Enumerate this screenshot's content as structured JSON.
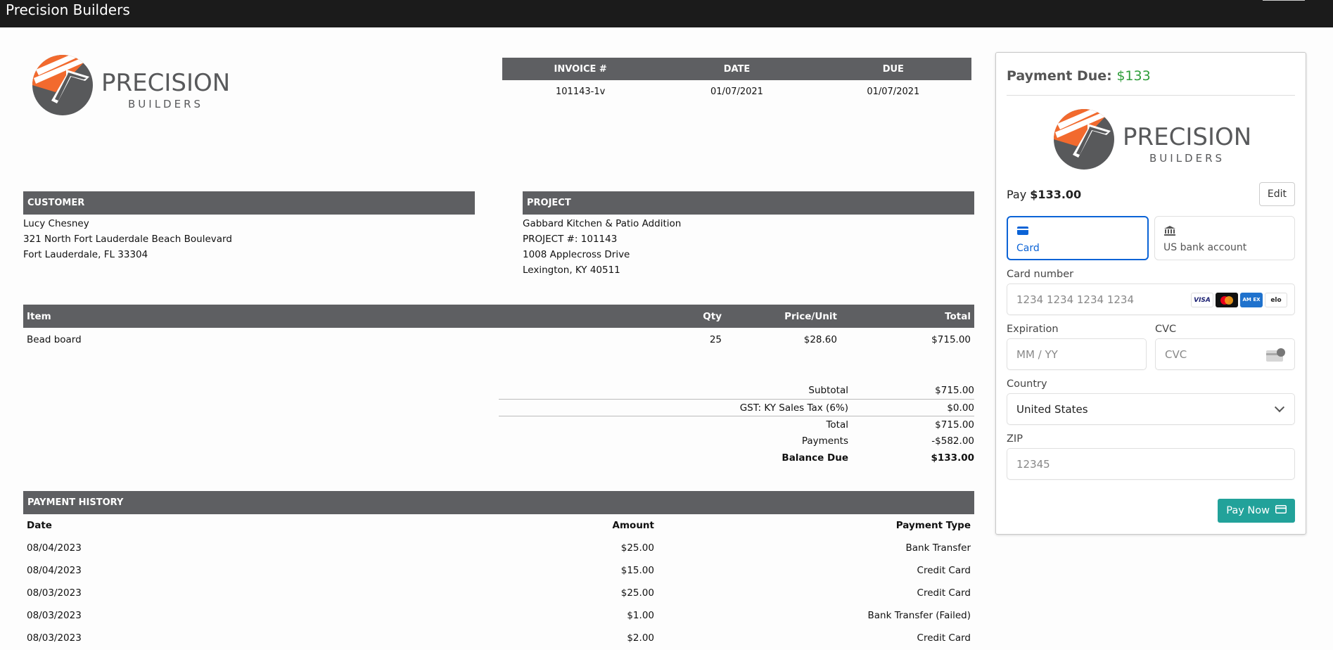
{
  "app": {
    "title": "Precision Builders"
  },
  "brand": {
    "name_top": "PRECISION",
    "name_bottom": "BUILDERS",
    "orange": "#f26a2e",
    "gray": "#58595b"
  },
  "invoice": {
    "headers": [
      "INVOICE #",
      "DATE",
      "DUE"
    ],
    "number": "101143-1v",
    "date": "01/07/2021",
    "due": "01/07/2021"
  },
  "customer": {
    "heading": "CUSTOMER",
    "name": "Lucy Chesney",
    "line1": "321 North Fort Lauderdale Beach Boulevard",
    "line2": "Fort Lauderdale, FL 33304"
  },
  "project": {
    "heading": "PROJECT",
    "name": "Gabbard Kitchen & Patio Addition",
    "number": "PROJECT #: 101143",
    "line1": "1008 Applecross Drive",
    "line2": "Lexington, KY 40511"
  },
  "items": {
    "headers": {
      "item": "Item",
      "qty": "Qty",
      "price": "Price/Unit",
      "total": "Total"
    },
    "rows": [
      {
        "item": "Bead board",
        "qty": "25",
        "price": "$28.60",
        "total": "$715.00"
      }
    ]
  },
  "totals": {
    "subtotal_label": "Subtotal",
    "subtotal": "$715.00",
    "tax_label": "GST: KY Sales Tax (6%)",
    "tax": "$0.00",
    "total_label": "Total",
    "total": "$715.00",
    "payments_label": "Payments",
    "payments": "-$582.00",
    "balance_label": "Balance Due",
    "balance": "$133.00"
  },
  "history": {
    "heading": "PAYMENT HISTORY",
    "headers": {
      "date": "Date",
      "amount": "Amount",
      "type": "Payment Type"
    },
    "rows": [
      {
        "date": "08/04/2023",
        "amount": "$25.00",
        "type": "Bank Transfer"
      },
      {
        "date": "08/04/2023",
        "amount": "$15.00",
        "type": "Credit Card"
      },
      {
        "date": "08/03/2023",
        "amount": "$25.00",
        "type": "Credit Card"
      },
      {
        "date": "08/03/2023",
        "amount": "$1.00",
        "type": "Bank Transfer (Failed)"
      },
      {
        "date": "08/03/2023",
        "amount": "$2.00",
        "type": "Credit Card"
      }
    ]
  },
  "payment": {
    "title": "Payment Due: ",
    "title_amount": "$133",
    "pay_prefix": "Pay ",
    "pay_amount": "$133.00",
    "edit_label": "Edit",
    "tab_card": "Card",
    "tab_bank": "US bank account",
    "card_number_label": "Card number",
    "card_number_placeholder": "1234 1234 1234 1234",
    "expiration_label": "Expiration",
    "expiration_placeholder": "MM / YY",
    "cvc_label": "CVC",
    "cvc_placeholder": "CVC",
    "country_label": "Country",
    "country_value": "United States",
    "zip_label": "ZIP",
    "zip_placeholder": "12345",
    "pay_now_label": "Pay Now",
    "card_brands": [
      "VISA",
      "",
      "AM EX",
      "elo"
    ],
    "accent": "#0b63d6",
    "button_color": "#22a29a",
    "amount_color": "#2e9d3a"
  }
}
